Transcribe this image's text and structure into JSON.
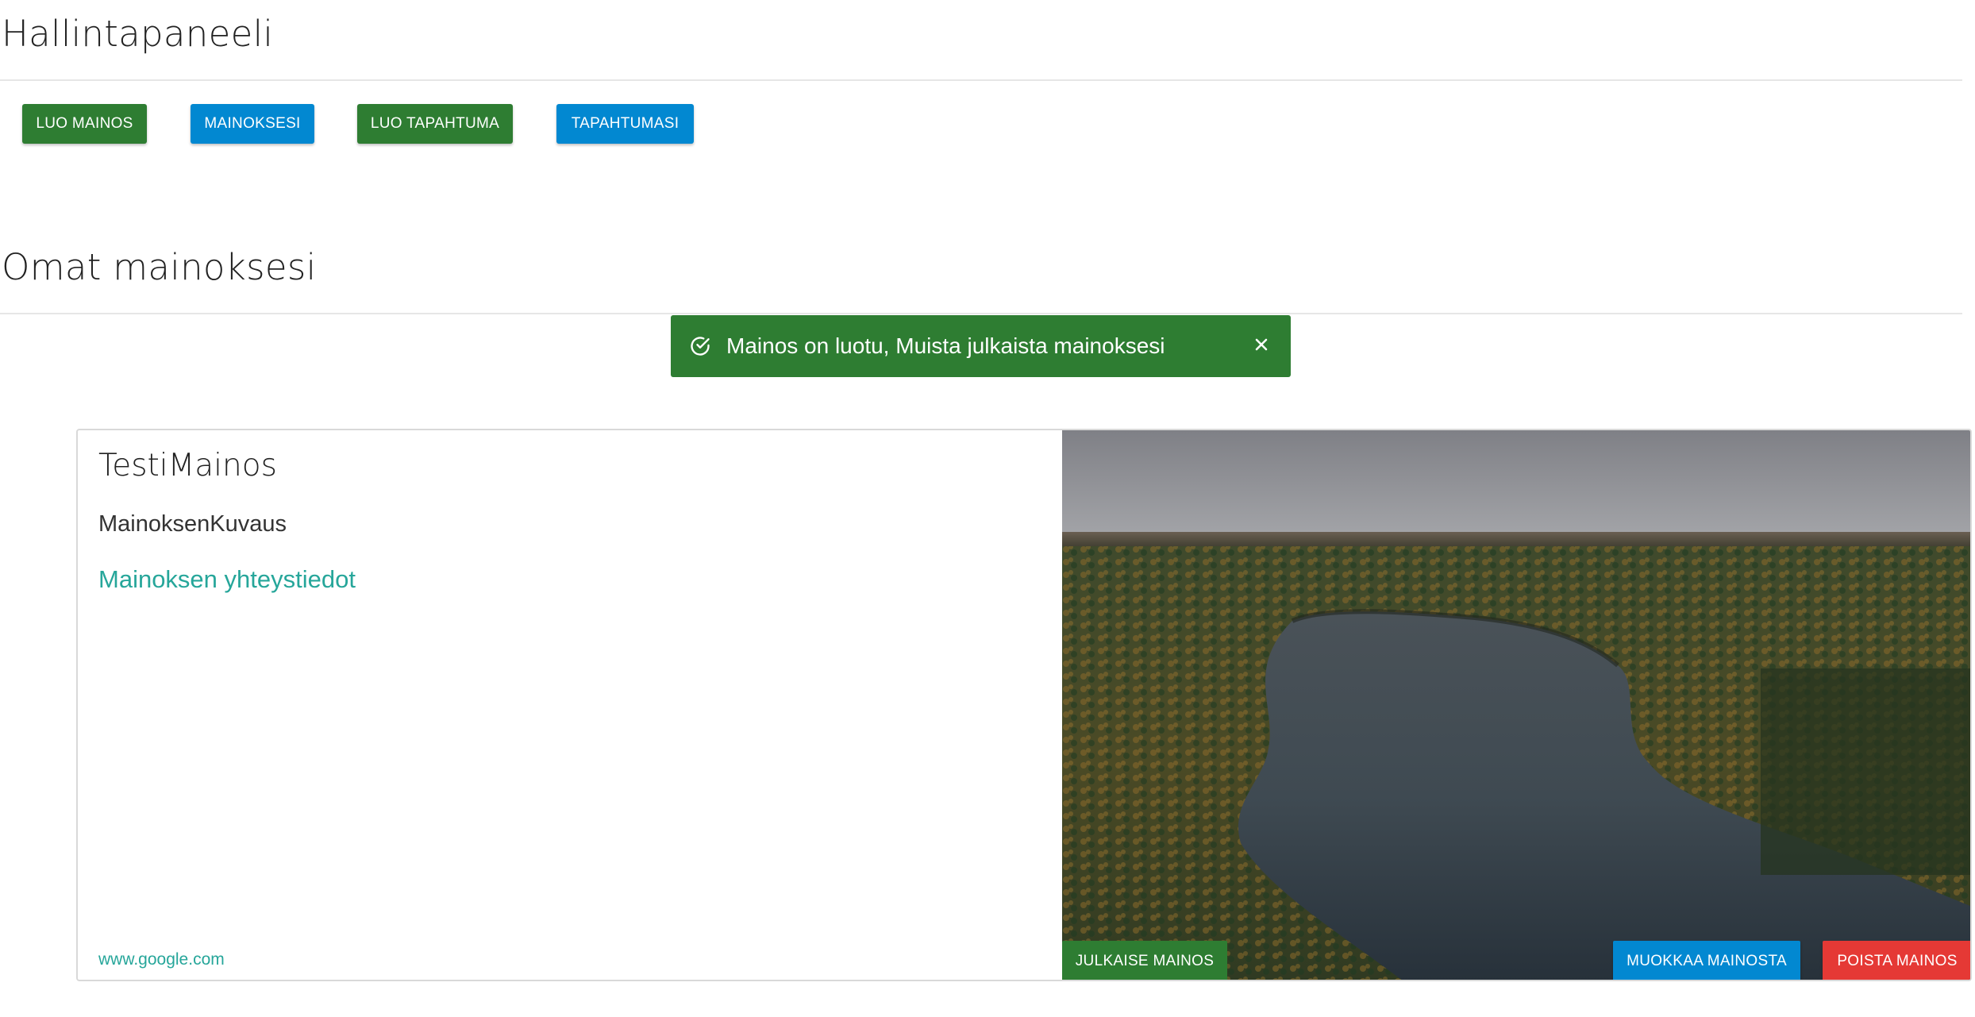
{
  "header": {
    "title": "Hallintapaneeli"
  },
  "toolbar": {
    "buttons": [
      {
        "label": "LUO MAINOS",
        "color": "#2e7d32"
      },
      {
        "label": "MAINOKSESI",
        "color": "#0288d1"
      },
      {
        "label": "LUO TAPAHTUMA",
        "color": "#2e7d32"
      },
      {
        "label": "TAPAHTUMASI",
        "color": "#0288d1"
      }
    ]
  },
  "section": {
    "title": "Omat mainoksesi"
  },
  "toast": {
    "icon": "check-circle-icon",
    "message": "Mainos on luotu, Muista julkaista mainoksesi",
    "close_icon": "close-icon",
    "color": "#2e7d32"
  },
  "ad_card": {
    "title": "TestiMainos",
    "description": "MainoksenKuvaus",
    "contact_link": "Mainoksen yhteystiedot",
    "url": "www.google.com",
    "image": "aerial-lake-forest-image",
    "actions": {
      "publish_label": "JULKAISE MAINOS",
      "edit_label": "MUOKKAA MAINOSTA",
      "delete_label": "POISTA MAINOS"
    }
  },
  "colors": {
    "green": "#2e7d32",
    "blue": "#0288d1",
    "red": "#e53935",
    "teal_link": "#26a69a"
  }
}
